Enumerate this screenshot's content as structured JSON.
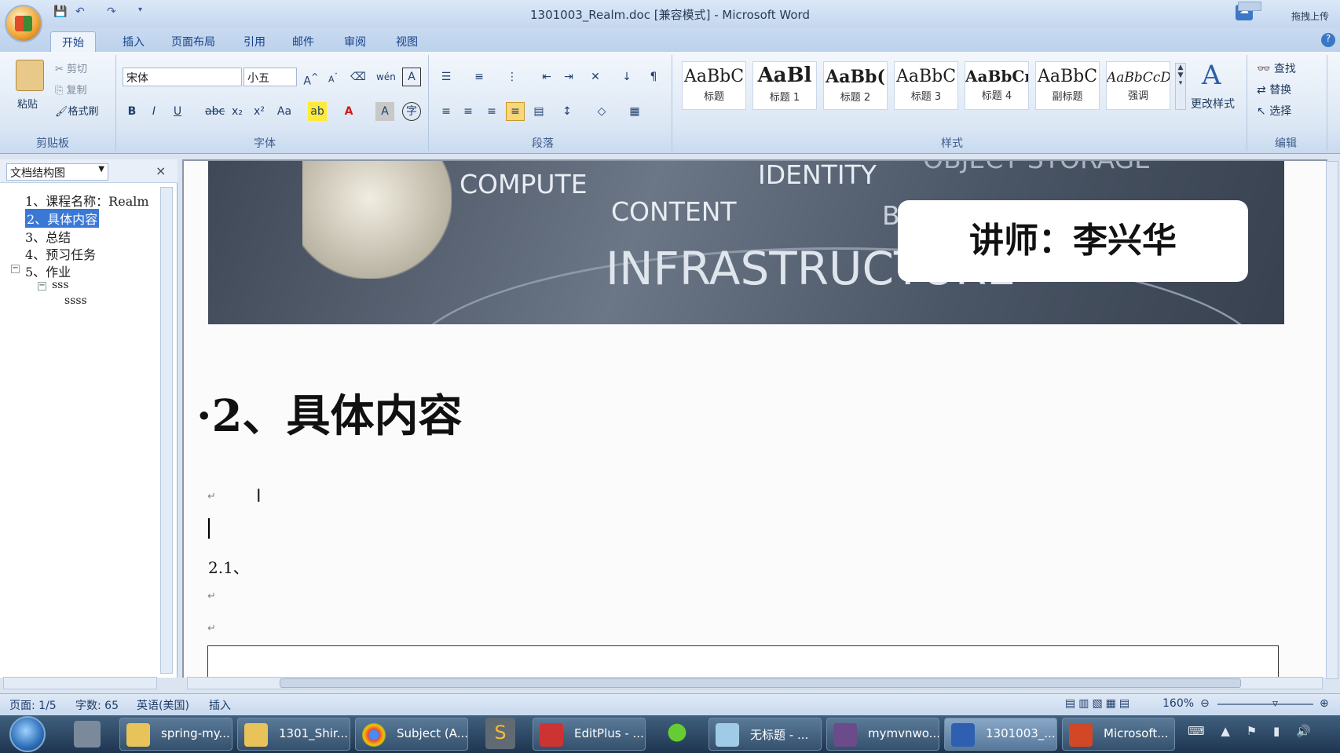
{
  "window": {
    "title": "1301003_Realm.doc [兼容模式] - Microsoft Word",
    "upload_btn": "拖拽上传"
  },
  "tabs": [
    "开始",
    "插入",
    "页面布局",
    "引用",
    "邮件",
    "审阅",
    "视图"
  ],
  "clipboard": {
    "paste": "粘贴",
    "cut": "剪切",
    "copy": "复制",
    "format_painter": "格式刷",
    "label": "剪贴板"
  },
  "font": {
    "name": "宋体",
    "size": "小五",
    "label": "字体"
  },
  "paragraph": {
    "label": "段落"
  },
  "styles": {
    "label": "样式",
    "items": [
      {
        "preview": "AaBbC",
        "name": "标题"
      },
      {
        "preview": "AaBl",
        "name": "标题 1"
      },
      {
        "preview": "AaBb(",
        "name": "标题 2"
      },
      {
        "preview": "AaBbC",
        "name": "标题 3"
      },
      {
        "preview": "AaBbCı",
        "name": "标题 4"
      },
      {
        "preview": "AaBbC",
        "name": "副标题"
      },
      {
        "preview": "AaBbCcDı",
        "name": "强调"
      }
    ],
    "change": "更改样式"
  },
  "editing": {
    "find": "查找",
    "replace": "替换",
    "select": "选择",
    "label": "编辑"
  },
  "nav": {
    "title": "文档结构图",
    "items": [
      "1、课程名称：Realm",
      "2、具体内容",
      "3、总结",
      "4、预习任务",
      "5、作业",
      "sss",
      "ssss"
    ]
  },
  "doc": {
    "banner_words": [
      "COMPUTE",
      "IDENTITY",
      "OBJECT STORAGE",
      "CONTENT",
      "INFRASTRUCTURE",
      "B"
    ],
    "lecturer": "讲师：李兴华",
    "heading": "·2、具体内容",
    "sub": "2.1、"
  },
  "status": {
    "page": "页面: 1/5",
    "words": "字数: 65",
    "lang": "英语(美国)",
    "mode": "插入",
    "zoom": "160%"
  },
  "taskbar": [
    "spring-my...",
    "1301_Shir...",
    "Subject (A...",
    "EditPlus - ...",
    "无标题 - ...",
    "mymvnwo...",
    "1301003_...",
    "Microsoft..."
  ]
}
